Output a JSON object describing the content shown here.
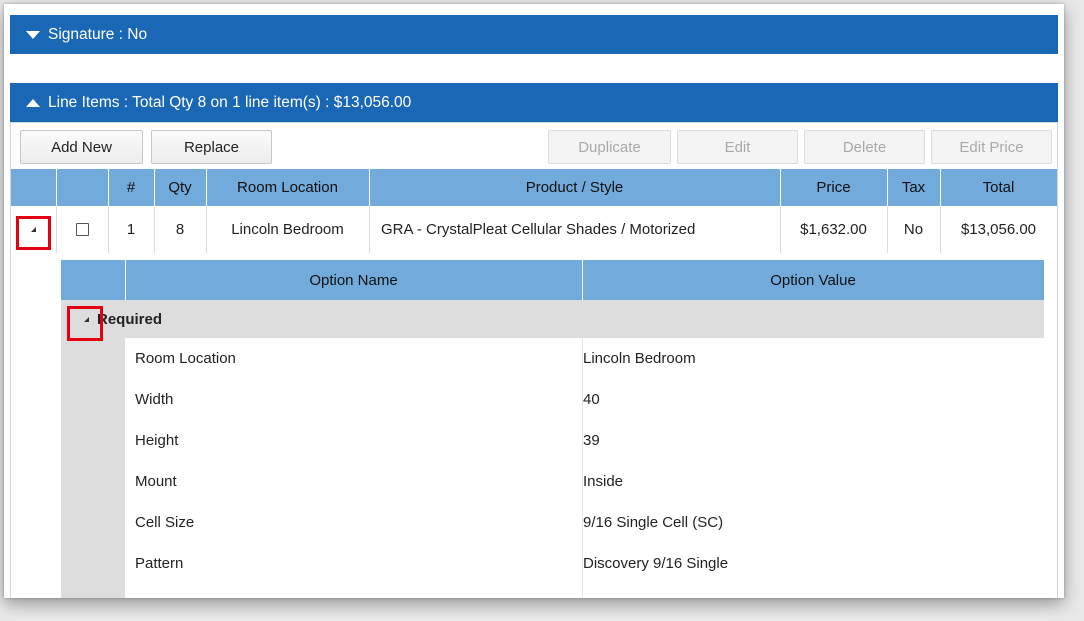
{
  "signature_header": {
    "label": "Signature : No"
  },
  "line_items_header": {
    "label": "Line Items : Total Qty 8 on 1 line item(s) : $13,056.00"
  },
  "toolbar": {
    "add_new": "Add New",
    "replace": "Replace",
    "duplicate": "Duplicate",
    "edit": "Edit",
    "delete": "Delete",
    "edit_price": "Edit Price"
  },
  "columns": {
    "num": "#",
    "qty": "Qty",
    "room_location": "Room Location",
    "product_style": "Product / Style",
    "price": "Price",
    "tax": "Tax",
    "total": "Total"
  },
  "rows": [
    {
      "num": "1",
      "qty": "8",
      "room_location": "Lincoln Bedroom",
      "product_style": "GRA - CrystalPleat Cellular Shades / Motorized",
      "price": "$1,632.00",
      "tax": "No",
      "total": "$13,056.00"
    }
  ],
  "detail": {
    "option_name_header": "Option Name",
    "option_value_header": "Option Value",
    "group_label": "Required",
    "options": [
      {
        "name": "Room Location",
        "value": "Lincoln Bedroom"
      },
      {
        "name": "Width",
        "value": "40"
      },
      {
        "name": "Height",
        "value": "39"
      },
      {
        "name": "Mount",
        "value": "Inside"
      },
      {
        "name": "Cell Size",
        "value": "9/16 Single Cell (SC)"
      },
      {
        "name": "Pattern",
        "value": "Discovery 9/16 Single"
      }
    ]
  },
  "colors": {
    "header_blue": "#1a68b5",
    "column_header_blue": "#72aadb",
    "highlight_red": "#e40010"
  }
}
